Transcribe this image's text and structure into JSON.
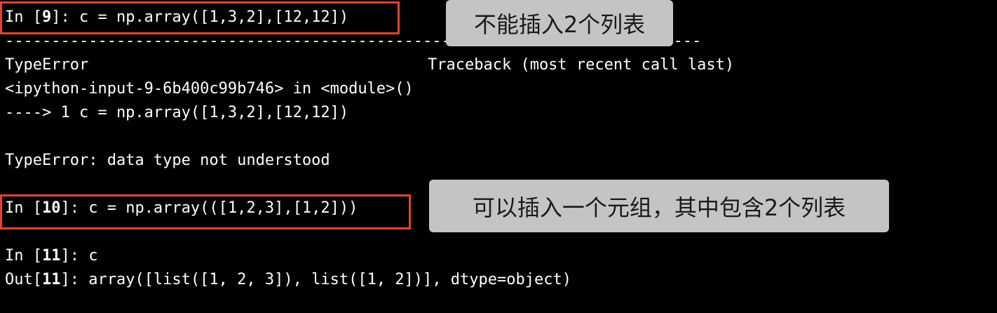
{
  "terminal": {
    "cell9_in_prefix": "In [",
    "cell9_num": "9",
    "cell9_code": "]: c = np.array([1,3,2],[12,12])",
    "dashes": "---------------------------------------------------------------------------",
    "error_type": "TypeError",
    "traceback_label": "Traceback (most recent call last)",
    "trace_location": "<ipython-input-9-6b400c99b746> in <module>()",
    "trace_line": "----> 1 c = np.array([1,3,2],[12,12])",
    "error_message": "TypeError: data type not understood",
    "cell10_in_prefix": "In [",
    "cell10_num": "10",
    "cell10_code": "]: c = np.array(([1,2,3],[1,2]))",
    "cell11_in_prefix": "In [",
    "cell11_num": "11",
    "cell11_code": "]: c",
    "out11_prefix": "Out[",
    "out11_num": "11",
    "out11_value": "]: array([list([1, 2, 3]), list([1, 2])], dtype=object)"
  },
  "annotations": {
    "callout_1": "不能插入2个列表",
    "callout_2": "可以插入一个元组，其中包含2个列表"
  },
  "colors": {
    "background": "#000000",
    "text": "#ffffff",
    "highlight_box": "#e0452f",
    "callout_bg": "#c4c4c4"
  }
}
